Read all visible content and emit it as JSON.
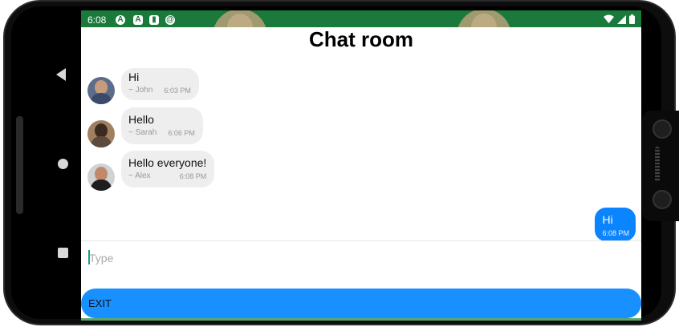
{
  "statusbar": {
    "time": "6:08",
    "icons": [
      "a-circle-icon",
      "a-square-icon",
      "sd-card-icon",
      "at-sign-icon"
    ],
    "right_icons": [
      "wifi-icon",
      "signal-icon",
      "battery-icon"
    ]
  },
  "header": {
    "title": "Chat room"
  },
  "messages": [
    {
      "text": "Hi",
      "author": "~ John",
      "time": "6:03 PM",
      "avatar_colors": {
        "bg": "#5b6d8a",
        "head": "#c79c7c",
        "body": "#394a6a"
      }
    },
    {
      "text": "Hello",
      "author": "~ Sarah",
      "time": "6:06 PM",
      "avatar_colors": {
        "bg": "#a08060",
        "head": "#3a2a20",
        "body": "#5c4a3a"
      }
    },
    {
      "text": "Hello everyone!",
      "author": "~ Alex",
      "time": "6:08 PM",
      "avatar_colors": {
        "bg": "#cfd3d6",
        "head": "#c08a6a",
        "body": "#1e1e1e"
      }
    }
  ],
  "my_message": {
    "text": "Hi",
    "time": "6:08 PM"
  },
  "composer": {
    "placeholder": "Type",
    "value": ""
  },
  "exit_button": {
    "label": "EXIT"
  },
  "colors": {
    "statusbar": "#1a7a3c",
    "my_bubble": "#0a84ff",
    "other_bubble": "#eeeeee",
    "exit_button": "#1890ff"
  }
}
